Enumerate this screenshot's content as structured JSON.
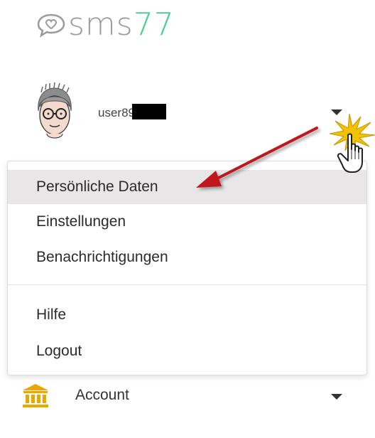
{
  "logo": {
    "text_sms": "sms",
    "text_77": "77",
    "icon": "chat-heart-icon"
  },
  "user": {
    "name_visible": "user89",
    "avatar_icon": "user-avatar-icon",
    "dropdown_icon": "caret-down-icon"
  },
  "menu": {
    "items": [
      {
        "label": "Persönliche Daten",
        "active": true
      },
      {
        "label": "Einstellungen"
      },
      {
        "label": "Benachrichtigungen"
      },
      {
        "label": "Hilfe"
      },
      {
        "label": "Logout"
      }
    ]
  },
  "account": {
    "label": "Account",
    "icon": "bank-icon",
    "dropdown_icon": "caret-down-icon"
  },
  "colors": {
    "brand_green": "#3fd08a",
    "logo_gray": "#9a9a9a",
    "arrow_red": "#c0141a",
    "bank_gold": "#e8a800"
  }
}
